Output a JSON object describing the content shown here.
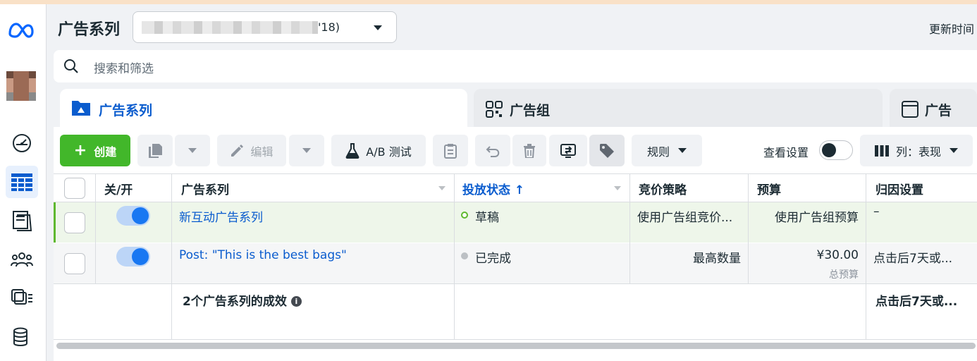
{
  "header": {
    "title": "广告系列",
    "campaign_select_suffix": "'18)",
    "update_time_label": "更新时间"
  },
  "search": {
    "placeholder": "搜索和筛选"
  },
  "tabs": [
    {
      "label": "广告系列",
      "active": true
    },
    {
      "label": "广告组",
      "active": false
    },
    {
      "label": "广告",
      "active": false
    }
  ],
  "toolbar": {
    "create_label": "创建",
    "edit_label": "编辑",
    "ab_test_label": "A/B 测试",
    "rules_label": "规则",
    "view_settings_label": "查看设置",
    "columns_label": "列：表现"
  },
  "table": {
    "columns": [
      "关/开",
      "广告系列",
      "投放状态 ↑",
      "竞价策略",
      "预算",
      "归因设置"
    ],
    "rows": [
      {
        "on": true,
        "name": "新互动广告系列",
        "status": "草稿",
        "bid_strategy": "使用广告组竞价...",
        "budget": "使用广告组预算",
        "budget_sub": "",
        "attribution": "–"
      },
      {
        "on": true,
        "name": "Post: \"This is the best bags\"",
        "status": "已完成",
        "bid_strategy": "最高数量",
        "budget": "¥30.00",
        "budget_sub": "总预算",
        "attribution": "点击后7天或..."
      }
    ],
    "summary": {
      "label": "2个广告系列的成效",
      "attribution": "点击后7天或..."
    }
  },
  "colors": {
    "accent": "#0a5cce",
    "create_green": "#42b72a",
    "switch_blue": "#1877f2",
    "draft_row_bg": "#eef6ea",
    "draft_status": "#5fb82f"
  },
  "icons": {
    "rail": [
      "meta-logo-icon",
      "gauge-icon",
      "table-grid-icon",
      "notebook-icon",
      "people-icon",
      "ad-library-icon",
      "database-icon"
    ],
    "toolbar": [
      "duplicate-icon",
      "pencil-icon",
      "flask-icon",
      "clipboard-icon",
      "undo-icon",
      "trash-icon",
      "export-icon",
      "tag-icon",
      "columns-icon"
    ]
  }
}
